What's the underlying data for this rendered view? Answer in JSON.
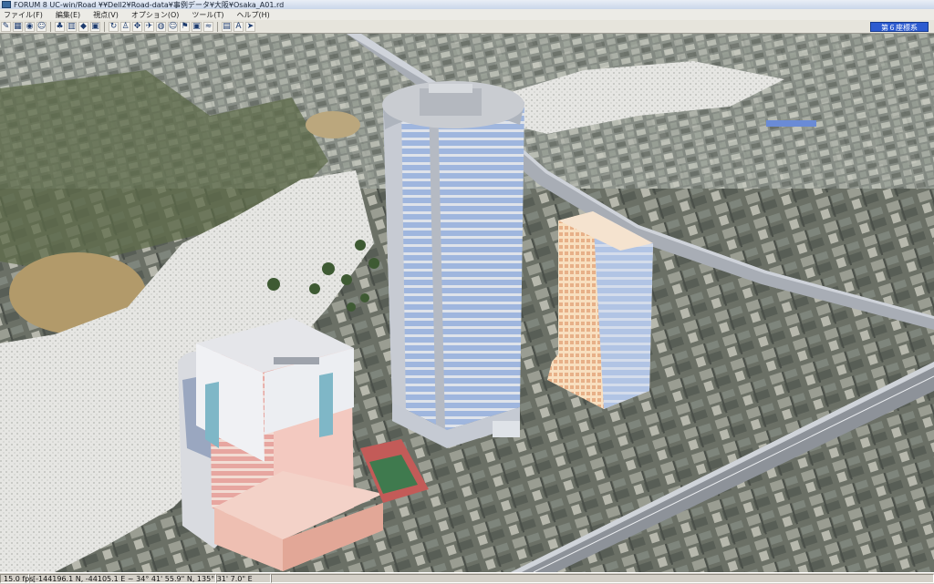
{
  "window": {
    "title": "FORUM 8    UC-win/Road    ¥¥Dell2¥Road-data¥事例データ¥大阪¥Osaka_A01.rd"
  },
  "menu": [
    "ファイル(F)",
    "編集(E)",
    "視点(V)",
    "オプション(O)",
    "ツール(T)",
    "ヘルプ(H)"
  ],
  "toolbar": {
    "coord_button": "第６座標系",
    "groups": [
      [
        "pencil-icon",
        "grid-icon",
        "camera-icon",
        "person-icon"
      ],
      [
        "tree-icon",
        "building-icon",
        "sign-icon",
        "car-icon"
      ],
      [
        "rotate-icon",
        "walk-icon",
        "move-icon",
        "plane-icon",
        "globe-icon",
        "person-icon",
        "flag-icon",
        "car-icon",
        "wave-icon"
      ],
      [
        "chart-icon",
        "text-icon",
        "run-icon"
      ]
    ]
  },
  "status": {
    "fps": "15.0 fps",
    "coords": "[-144196.1 N, -44105.1 E ~ 34° 41' 55.9\" N, 135° 31' 7.0\" E"
  },
  "colors": {
    "coord_button": "#2d5bd0",
    "window": "#d4d0c8"
  }
}
